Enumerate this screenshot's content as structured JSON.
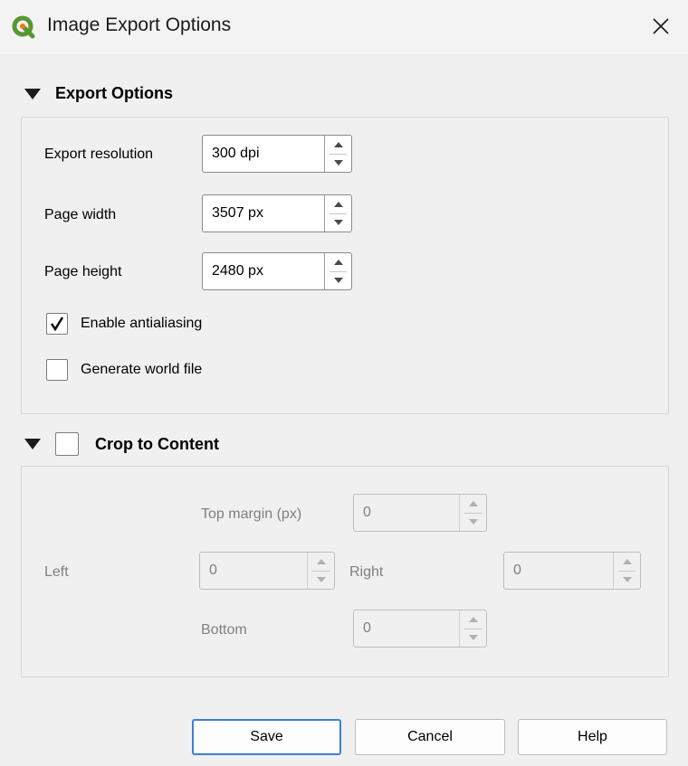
{
  "window": {
    "title": "Image Export Options"
  },
  "export_options": {
    "header": "Export Options",
    "resolution": {
      "label": "Export resolution",
      "value": "300 dpi"
    },
    "page_width": {
      "label": "Page width",
      "value": "3507 px"
    },
    "page_height": {
      "label": "Page height",
      "value": "2480 px"
    },
    "antialiasing": {
      "label": "Enable antialiasing",
      "checked": true
    },
    "world_file": {
      "label": "Generate world file",
      "checked": false
    }
  },
  "crop": {
    "header": "Crop to Content",
    "checked": false,
    "top": {
      "label": "Top margin (px)",
      "value": "0"
    },
    "left": {
      "label": "Left",
      "value": "0"
    },
    "right": {
      "label": "Right",
      "value": "0"
    },
    "bottom": {
      "label": "Bottom",
      "value": "0"
    }
  },
  "buttons": {
    "save": "Save",
    "cancel": "Cancel",
    "help": "Help"
  },
  "colors": {
    "accent": "#3c7fd6",
    "qgis_green": "#589632",
    "qgis_yellow": "#ee7913"
  },
  "icons": [
    "qgis-logo-icon",
    "close-icon",
    "collapse-triangle-icon",
    "checkmark-icon",
    "spin-up-icon",
    "spin-down-icon"
  ]
}
